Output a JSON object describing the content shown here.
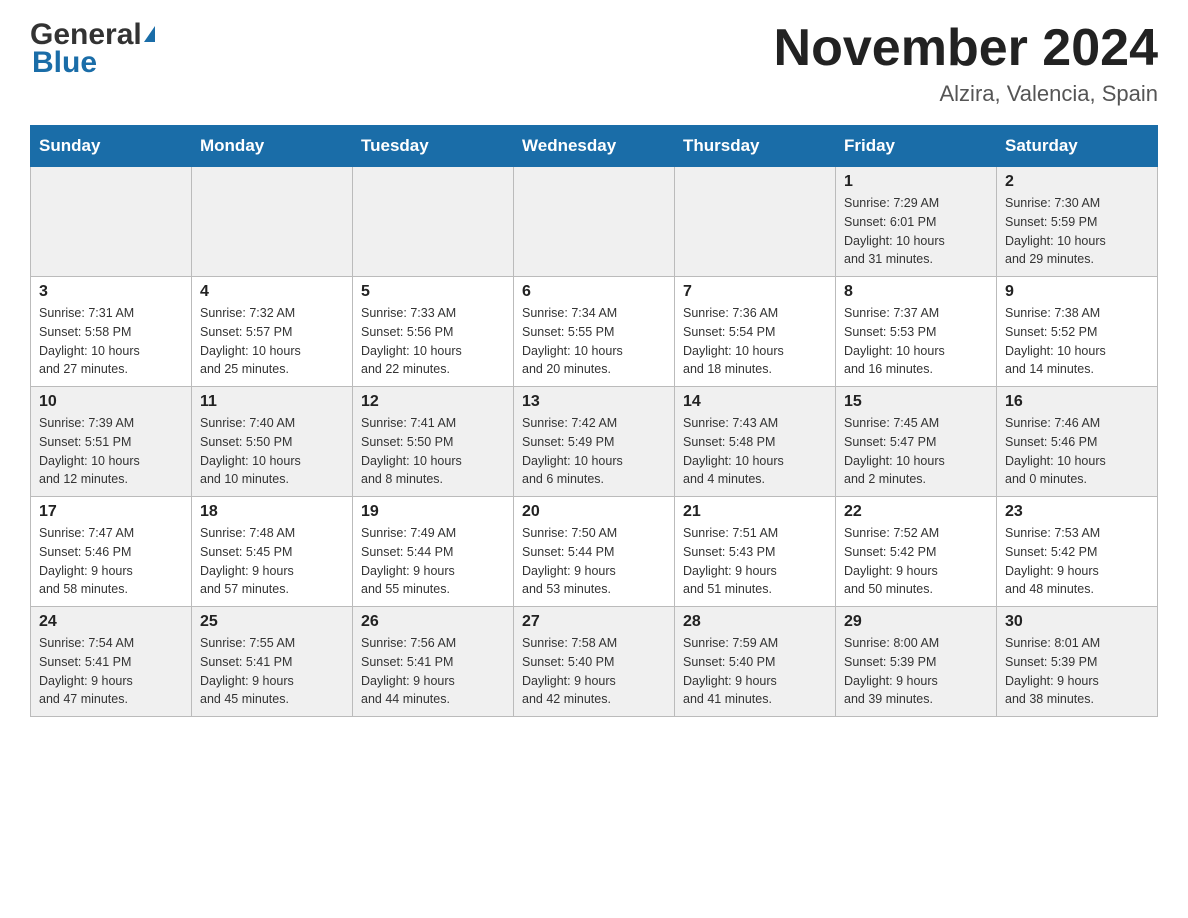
{
  "header": {
    "logo_general": "General",
    "logo_blue": "Blue",
    "month_title": "November 2024",
    "location": "Alzira, Valencia, Spain"
  },
  "weekdays": [
    "Sunday",
    "Monday",
    "Tuesday",
    "Wednesday",
    "Thursday",
    "Friday",
    "Saturday"
  ],
  "weeks": [
    {
      "days": [
        {
          "num": "",
          "info": ""
        },
        {
          "num": "",
          "info": ""
        },
        {
          "num": "",
          "info": ""
        },
        {
          "num": "",
          "info": ""
        },
        {
          "num": "",
          "info": ""
        },
        {
          "num": "1",
          "info": "Sunrise: 7:29 AM\nSunset: 6:01 PM\nDaylight: 10 hours\nand 31 minutes."
        },
        {
          "num": "2",
          "info": "Sunrise: 7:30 AM\nSunset: 5:59 PM\nDaylight: 10 hours\nand 29 minutes."
        }
      ]
    },
    {
      "days": [
        {
          "num": "3",
          "info": "Sunrise: 7:31 AM\nSunset: 5:58 PM\nDaylight: 10 hours\nand 27 minutes."
        },
        {
          "num": "4",
          "info": "Sunrise: 7:32 AM\nSunset: 5:57 PM\nDaylight: 10 hours\nand 25 minutes."
        },
        {
          "num": "5",
          "info": "Sunrise: 7:33 AM\nSunset: 5:56 PM\nDaylight: 10 hours\nand 22 minutes."
        },
        {
          "num": "6",
          "info": "Sunrise: 7:34 AM\nSunset: 5:55 PM\nDaylight: 10 hours\nand 20 minutes."
        },
        {
          "num": "7",
          "info": "Sunrise: 7:36 AM\nSunset: 5:54 PM\nDaylight: 10 hours\nand 18 minutes."
        },
        {
          "num": "8",
          "info": "Sunrise: 7:37 AM\nSunset: 5:53 PM\nDaylight: 10 hours\nand 16 minutes."
        },
        {
          "num": "9",
          "info": "Sunrise: 7:38 AM\nSunset: 5:52 PM\nDaylight: 10 hours\nand 14 minutes."
        }
      ]
    },
    {
      "days": [
        {
          "num": "10",
          "info": "Sunrise: 7:39 AM\nSunset: 5:51 PM\nDaylight: 10 hours\nand 12 minutes."
        },
        {
          "num": "11",
          "info": "Sunrise: 7:40 AM\nSunset: 5:50 PM\nDaylight: 10 hours\nand 10 minutes."
        },
        {
          "num": "12",
          "info": "Sunrise: 7:41 AM\nSunset: 5:50 PM\nDaylight: 10 hours\nand 8 minutes."
        },
        {
          "num": "13",
          "info": "Sunrise: 7:42 AM\nSunset: 5:49 PM\nDaylight: 10 hours\nand 6 minutes."
        },
        {
          "num": "14",
          "info": "Sunrise: 7:43 AM\nSunset: 5:48 PM\nDaylight: 10 hours\nand 4 minutes."
        },
        {
          "num": "15",
          "info": "Sunrise: 7:45 AM\nSunset: 5:47 PM\nDaylight: 10 hours\nand 2 minutes."
        },
        {
          "num": "16",
          "info": "Sunrise: 7:46 AM\nSunset: 5:46 PM\nDaylight: 10 hours\nand 0 minutes."
        }
      ]
    },
    {
      "days": [
        {
          "num": "17",
          "info": "Sunrise: 7:47 AM\nSunset: 5:46 PM\nDaylight: 9 hours\nand 58 minutes."
        },
        {
          "num": "18",
          "info": "Sunrise: 7:48 AM\nSunset: 5:45 PM\nDaylight: 9 hours\nand 57 minutes."
        },
        {
          "num": "19",
          "info": "Sunrise: 7:49 AM\nSunset: 5:44 PM\nDaylight: 9 hours\nand 55 minutes."
        },
        {
          "num": "20",
          "info": "Sunrise: 7:50 AM\nSunset: 5:44 PM\nDaylight: 9 hours\nand 53 minutes."
        },
        {
          "num": "21",
          "info": "Sunrise: 7:51 AM\nSunset: 5:43 PM\nDaylight: 9 hours\nand 51 minutes."
        },
        {
          "num": "22",
          "info": "Sunrise: 7:52 AM\nSunset: 5:42 PM\nDaylight: 9 hours\nand 50 minutes."
        },
        {
          "num": "23",
          "info": "Sunrise: 7:53 AM\nSunset: 5:42 PM\nDaylight: 9 hours\nand 48 minutes."
        }
      ]
    },
    {
      "days": [
        {
          "num": "24",
          "info": "Sunrise: 7:54 AM\nSunset: 5:41 PM\nDaylight: 9 hours\nand 47 minutes."
        },
        {
          "num": "25",
          "info": "Sunrise: 7:55 AM\nSunset: 5:41 PM\nDaylight: 9 hours\nand 45 minutes."
        },
        {
          "num": "26",
          "info": "Sunrise: 7:56 AM\nSunset: 5:41 PM\nDaylight: 9 hours\nand 44 minutes."
        },
        {
          "num": "27",
          "info": "Sunrise: 7:58 AM\nSunset: 5:40 PM\nDaylight: 9 hours\nand 42 minutes."
        },
        {
          "num": "28",
          "info": "Sunrise: 7:59 AM\nSunset: 5:40 PM\nDaylight: 9 hours\nand 41 minutes."
        },
        {
          "num": "29",
          "info": "Sunrise: 8:00 AM\nSunset: 5:39 PM\nDaylight: 9 hours\nand 39 minutes."
        },
        {
          "num": "30",
          "info": "Sunrise: 8:01 AM\nSunset: 5:39 PM\nDaylight: 9 hours\nand 38 minutes."
        }
      ]
    }
  ]
}
